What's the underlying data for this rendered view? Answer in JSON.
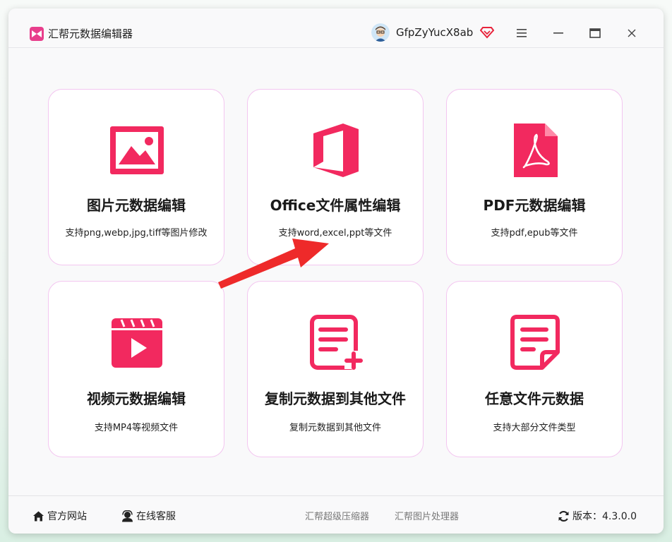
{
  "app": {
    "title": "汇帮元数据编辑器"
  },
  "user": {
    "name": "GfpZyYucX8ab"
  },
  "cards": [
    {
      "title": "图片元数据编辑",
      "desc": "支持png,webp,jpg,tiff等图片修改",
      "icon": "image-icon"
    },
    {
      "title": "Office文件属性编辑",
      "desc": "支持word,excel,ppt等文件",
      "icon": "office-icon"
    },
    {
      "title": "PDF元数据编辑",
      "desc": "支持pdf,epub等文件",
      "icon": "pdf-icon"
    },
    {
      "title": "视频元数据编辑",
      "desc": "支持MP4等视频文件",
      "icon": "video-icon"
    },
    {
      "title": "复制元数据到其他文件",
      "desc": "复制元数据到其他文件",
      "icon": "document-add-icon"
    },
    {
      "title": "任意文件元数据",
      "desc": "支持大部分文件类型",
      "icon": "document-icon"
    }
  ],
  "footer": {
    "website": "官方网站",
    "support": "在线客服",
    "link1": "汇帮超级压缩器",
    "link2": "汇帮图片处理器",
    "version": "版本：4.3.0.0"
  },
  "colors": {
    "accent": "#f2295f",
    "card_border": "#f3c6f0",
    "annotation_arrow": "#ee2a2a"
  }
}
